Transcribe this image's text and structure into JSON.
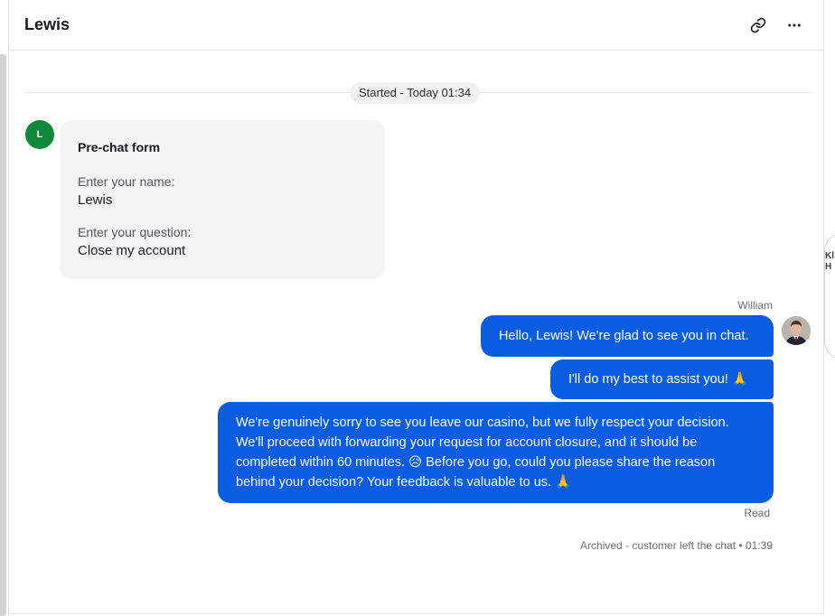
{
  "header": {
    "title": "Lewis",
    "copy_link_icon": "link-icon",
    "more_icon": "more-horizontal-icon"
  },
  "divider": {
    "text": "Started - Today 01:34"
  },
  "customer": {
    "avatar_initial": "L",
    "avatar_color": "#0f8a3a"
  },
  "prechat_form": {
    "title": "Pre-chat form",
    "fields": [
      {
        "label": "Enter your name:",
        "value": "Lewis"
      },
      {
        "label": "Enter your question:",
        "value": "Close my account"
      }
    ]
  },
  "agent": {
    "name": "William",
    "messages": [
      "Hello, Lewis! We're glad to see you in chat.",
      "I'll do my best to assist you! 🙏",
      "We're genuinely sorry to see you leave our casino, but we fully respect your decision. We'll proceed with forwarding your request for account closure, and it should be completed within 60 minutes. 😥 Before you go, could you please share the reason behind your decision? Your feedback is valuable to us. 🙏"
    ],
    "bubble_color": "#0a5ce0"
  },
  "status": {
    "read": "Read",
    "archived": "Archived - customer left the chat • 01:39"
  },
  "right_sliver": {
    "line1": "Kl",
    "line2": "H"
  }
}
